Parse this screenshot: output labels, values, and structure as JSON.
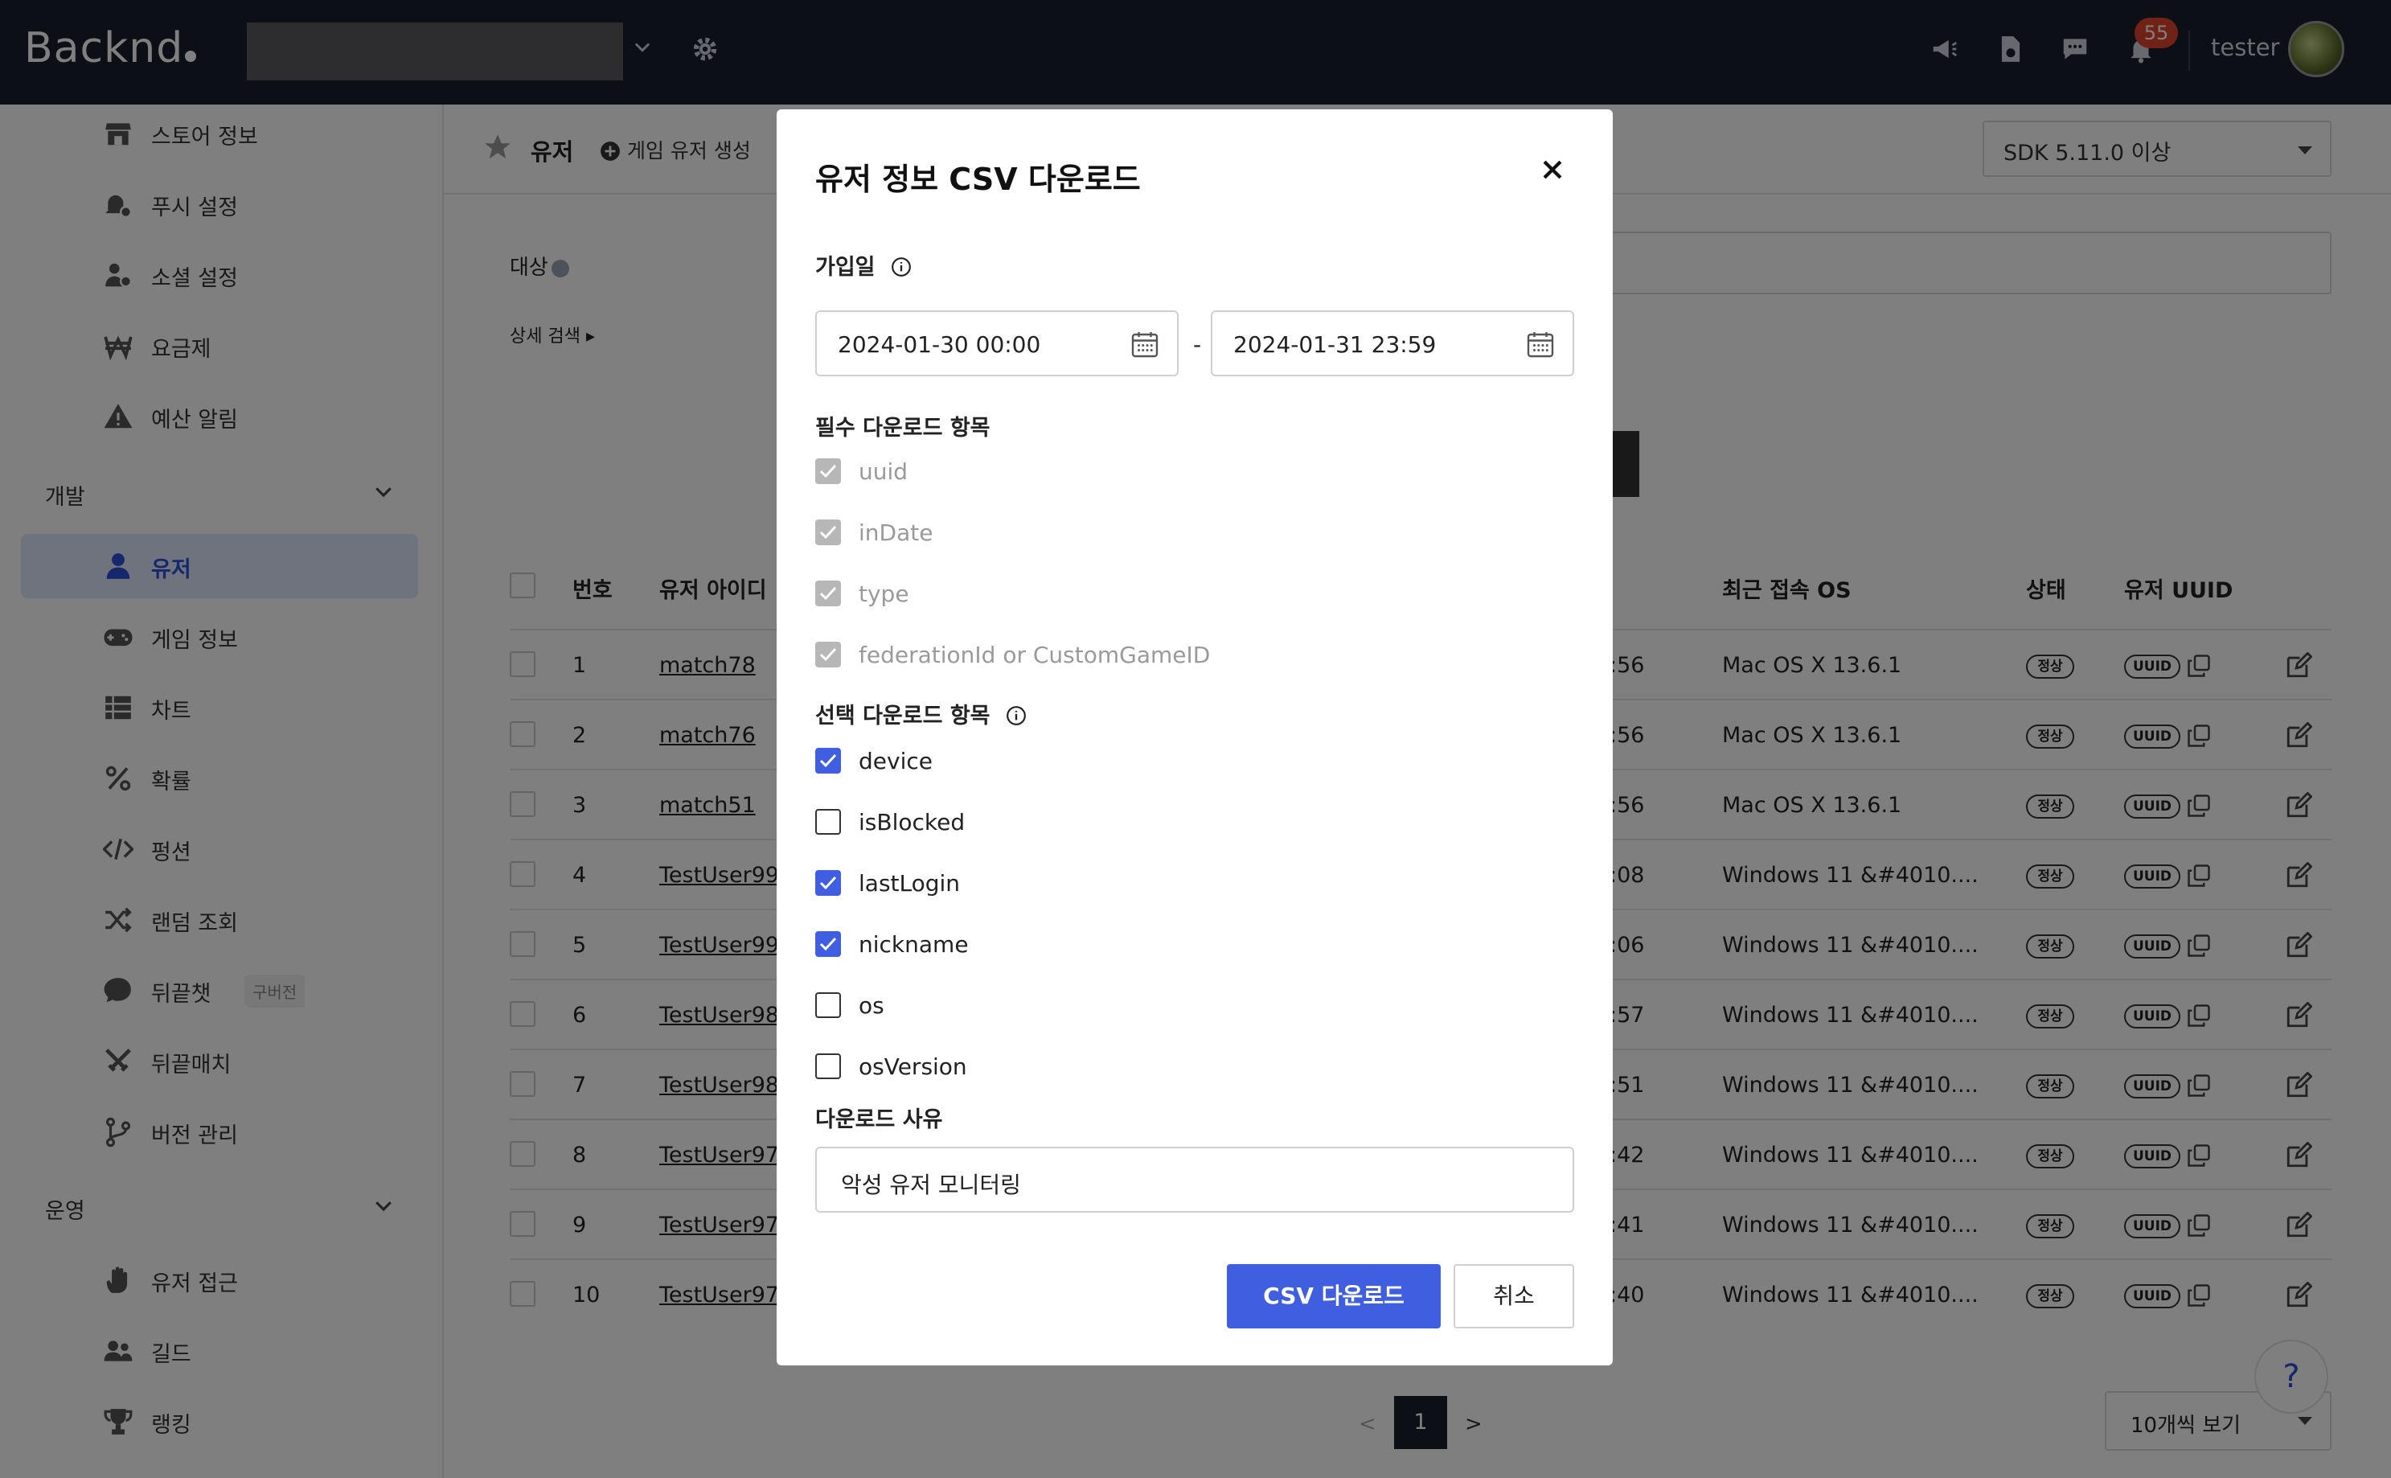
{
  "topbar": {
    "logo": "Backnd",
    "badge_count": "55",
    "username": "tester"
  },
  "sidebar": {
    "items": [
      {
        "label": "스토어 정보",
        "icon": "store-icon"
      },
      {
        "label": "푸시 설정",
        "icon": "bell-gear-icon"
      },
      {
        "label": "소셜 설정",
        "icon": "users-gear-icon"
      },
      {
        "label": "요금제",
        "icon": "won-icon"
      },
      {
        "label": "예산 알림",
        "icon": "warning-icon"
      }
    ],
    "sections": {
      "dev": "개발",
      "ops": "운영"
    },
    "dev_items": [
      {
        "label": "유저",
        "icon": "user-icon"
      },
      {
        "label": "게임 정보",
        "icon": "gamepad-icon"
      },
      {
        "label": "차트",
        "icon": "table-icon"
      },
      {
        "label": "확률",
        "icon": "percent-icon"
      },
      {
        "label": "펑션",
        "icon": "code-icon"
      },
      {
        "label": "랜덤 조회",
        "icon": "shuffle-icon"
      },
      {
        "label": "뒤끝챗",
        "icon": "chat-icon",
        "tag": "구버전"
      },
      {
        "label": "뒤끝매치",
        "icon": "swords-icon"
      },
      {
        "label": "버전 관리",
        "icon": "branch-icon"
      }
    ],
    "ops_items": [
      {
        "label": "유저 접근",
        "icon": "hand-icon"
      },
      {
        "label": "길드",
        "icon": "group-icon"
      },
      {
        "label": "랭킹",
        "icon": "trophy-icon"
      }
    ]
  },
  "main": {
    "title": "유저",
    "create_label": "게임 유저 생성",
    "sdk_select": "SDK 5.11.0 이상",
    "target_label": "대상",
    "detail_search": "상세 검색",
    "columns": {
      "number": "번호",
      "user_id": "유저 아이디",
      "os": "최근 접속 OS",
      "status": "상태",
      "uuid": "유저 UUID"
    },
    "rows": [
      {
        "no": "1",
        "id": "match78",
        "time": ":56",
        "os": "Mac OS X 13.6.1",
        "status": "정상",
        "uuid": "UUID"
      },
      {
        "no": "2",
        "id": "match76",
        "time": ":56",
        "os": "Mac OS X 13.6.1",
        "status": "정상",
        "uuid": "UUID"
      },
      {
        "no": "3",
        "id": "match51",
        "time": ":56",
        "os": "Mac OS X 13.6.1",
        "status": "정상",
        "uuid": "UUID"
      },
      {
        "no": "4",
        "id": "TestUser99",
        "time": ":08",
        "os": "Windows 11 &#4010....",
        "status": "정상",
        "uuid": "UUID"
      },
      {
        "no": "5",
        "id": "TestUser99",
        "time": ":06",
        "os": "Windows 11 &#4010....",
        "status": "정상",
        "uuid": "UUID"
      },
      {
        "no": "6",
        "id": "TestUser98",
        "time": ":57",
        "os": "Windows 11 &#4010....",
        "status": "정상",
        "uuid": "UUID"
      },
      {
        "no": "7",
        "id": "TestUser98",
        "time": ":51",
        "os": "Windows 11 &#4010....",
        "status": "정상",
        "uuid": "UUID"
      },
      {
        "no": "8",
        "id": "TestUser97",
        "time": ":42",
        "os": "Windows 11 &#4010....",
        "status": "정상",
        "uuid": "UUID"
      },
      {
        "no": "9",
        "id": "TestUser97",
        "time": ":41",
        "os": "Windows 11 &#4010....",
        "status": "정상",
        "uuid": "UUID"
      },
      {
        "no": "10",
        "id": "TestUser97",
        "time": ":40",
        "os": "Windows 11 &#4010....",
        "status": "정상",
        "uuid": "UUID"
      }
    ],
    "pager": {
      "prev": "<",
      "current": "1",
      "next": ">"
    },
    "per_page": "10개씩 보기",
    "help": "?"
  },
  "modal": {
    "title": "유저 정보 CSV 다운로드",
    "join_date_label": "가입일",
    "date_from": "2024-01-30 00:00",
    "date_to": "2024-01-31 23:59",
    "date_sep": "-",
    "required_label": "필수 다운로드 항목",
    "required": [
      "uuid",
      "inDate",
      "type",
      "federationId or CustomGameID"
    ],
    "optional_label": "선택 다운로드 항목",
    "optional": [
      {
        "label": "device",
        "checked": true
      },
      {
        "label": "isBlocked",
        "checked": false
      },
      {
        "label": "lastLogin",
        "checked": true
      },
      {
        "label": "nickname",
        "checked": true
      },
      {
        "label": "os",
        "checked": false
      },
      {
        "label": "osVersion",
        "checked": false
      }
    ],
    "reason_label": "다운로드 사유",
    "reason_value": "악성 유저 모니터링",
    "download_button": "CSV 다운로드",
    "cancel_button": "취소"
  },
  "colors": {
    "topbar": "#1b1e2e",
    "accent": "#3f5fe0",
    "badge": "#e0442f",
    "active_bg": "#dfe6fb"
  }
}
